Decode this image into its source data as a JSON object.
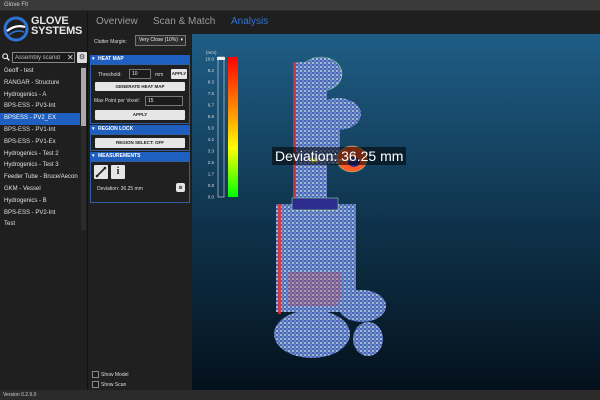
{
  "window": {
    "title": "Glove Fit"
  },
  "logo": {
    "line1": "GLOVE",
    "line2": "SYSTEMS"
  },
  "search": {
    "value": "",
    "placeholder": "Assembly scanid"
  },
  "assets": [
    {
      "label": "Geoff - test"
    },
    {
      "label": "RANGAR - Structure"
    },
    {
      "label": "Hydrogenics - A"
    },
    {
      "label": "BPS-ESS - PV3-Int"
    },
    {
      "label": "BPSESS - PV2_EX"
    },
    {
      "label": "BPS-ESS - PV1-Int"
    },
    {
      "label": "BPS-ESS - PV1-Ex"
    },
    {
      "label": "Hydrogenics - Test 2"
    },
    {
      "label": "Hydrogenics - Test 3"
    },
    {
      "label": "Feeder Tube - Bruce/Aecon"
    },
    {
      "label": "GKM - Vessel"
    },
    {
      "label": "Hydrogenics - B"
    },
    {
      "label": "BPS-ESS - PV2-Int"
    },
    {
      "label": "Test"
    }
  ],
  "selected_asset_index": 4,
  "tabs": [
    {
      "label": "Overview"
    },
    {
      "label": "Scan & Match"
    },
    {
      "label": "Analysis"
    }
  ],
  "active_tab_index": 2,
  "clutter": {
    "label": "Clutter Margin:",
    "value": "Very Close (10%)"
  },
  "heatmap": {
    "title": "HEAT MAP",
    "threshold_label": "Threshold:",
    "threshold_value": "10",
    "threshold_unit": "mm",
    "apply_small": "APPLY",
    "generate": "GENERATE HEAT MAP",
    "max_point_label": "Max Point per Voxel:",
    "max_point_value": "15",
    "apply": "APPLY"
  },
  "region_lock": {
    "title": "REGION LOCK",
    "button": "REGION SELECT: OFF"
  },
  "measurements": {
    "title": "MEASUREMENTS",
    "result": "Deviation: 36.25 mm"
  },
  "bottom": {
    "show_model": "Show Model",
    "show_scan": "Show Scan"
  },
  "colorbar": {
    "unit": "(mm)",
    "ticks": [
      "10.0",
      "9.2",
      "8.3",
      "7.5",
      "6.7",
      "5.8",
      "5.0",
      "4.2",
      "3.3",
      "2.5",
      "1.7",
      "0.8",
      "0.0"
    ]
  },
  "viewport": {
    "deviation_label": "Deviation: 36.25 mm"
  },
  "status": {
    "version": "Version 0.2.9.0"
  },
  "colors": {
    "accent": "#1f5fbf",
    "tab_active": "#2e74d8"
  }
}
